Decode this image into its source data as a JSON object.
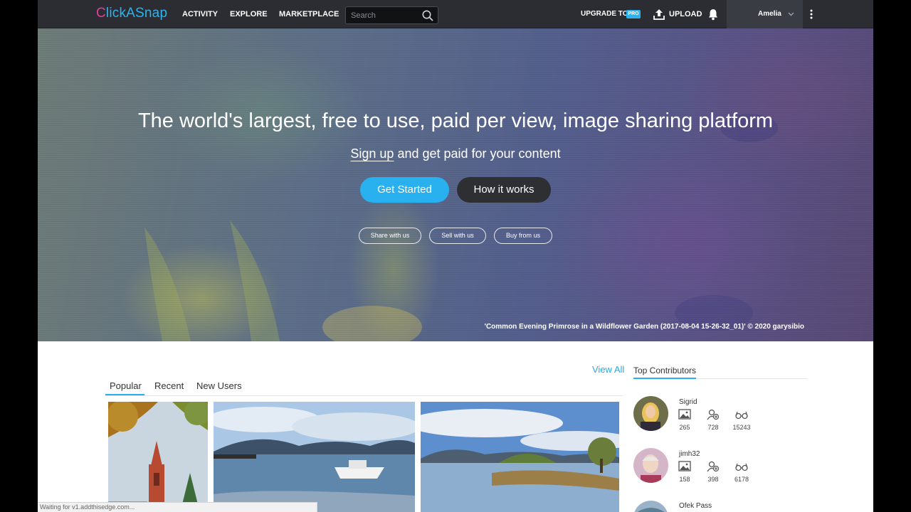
{
  "brand": {
    "logo_c": "C",
    "logo_rest": "lickASnap"
  },
  "nav": {
    "activity": "ACTIVITY",
    "explore": "EXPLORE",
    "marketplace": "MARKETPLACE"
  },
  "search": {
    "placeholder": "Search",
    "icon": "search-icon"
  },
  "header_right": {
    "upgrade": "UPGRADE TO",
    "pro": "PRO",
    "upload": "UPLOAD",
    "user": "Amelia"
  },
  "hero": {
    "title": "The world's largest, free to use, paid per view, image sharing platform",
    "signup": "Sign up",
    "sub_rest": " and get paid for your content",
    "get_started": "Get Started",
    "how_it_works": "How it works",
    "pills": [
      "Share with us",
      "Sell with us",
      "Buy from us"
    ],
    "caption": "'Common Evening Primrose in a Wildflower Garden (2017-08-04 15-26-32_01)' © 2020 garysibio"
  },
  "tabs": [
    "Popular",
    "Recent",
    "New Users"
  ],
  "view_all": "View All",
  "contributors": {
    "title": "Top Contributors",
    "items": [
      {
        "name": "Sigrid",
        "images": "265",
        "followers": "728",
        "views": "15243"
      },
      {
        "name": "jimh32",
        "images": "158",
        "followers": "398",
        "views": "6178"
      },
      {
        "name": "Ofek Pass"
      }
    ]
  },
  "status": "Waiting for v1.addthisedge.com..."
}
